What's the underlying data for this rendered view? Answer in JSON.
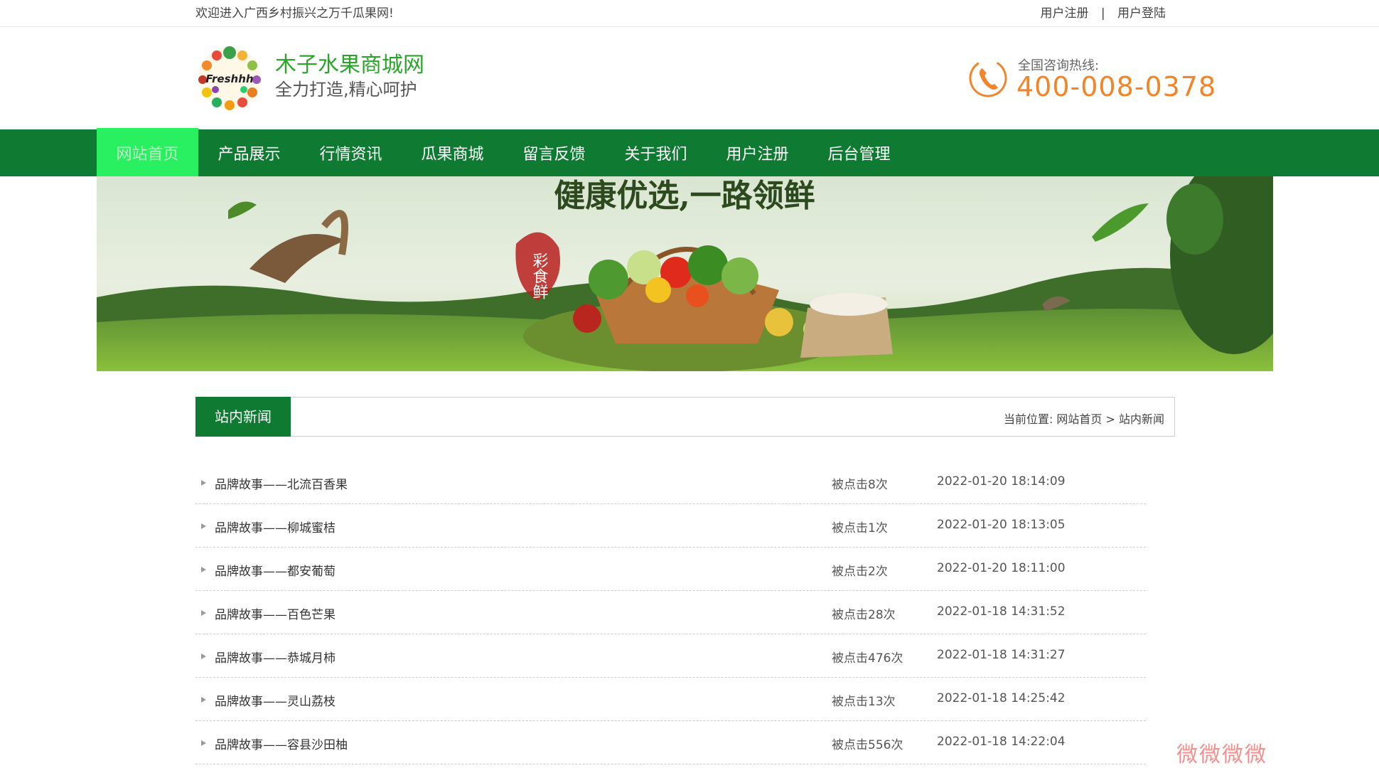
{
  "topbar": {
    "welcome": "欢迎进入广西乡村振兴之万千瓜果网!",
    "register": "用户注册",
    "separator": "|",
    "login": "用户登陆"
  },
  "header": {
    "logo_text": "Freshhh",
    "brand_name": "木子水果商城网",
    "slogan": "全力打造,精心呵护",
    "hotline_label": "全国咨询热线:",
    "hotline_number": "400-008-0378"
  },
  "nav": {
    "items": [
      {
        "label": "网站首页",
        "active": true
      },
      {
        "label": "产品展示",
        "active": false
      },
      {
        "label": "行情资讯",
        "active": false
      },
      {
        "label": "瓜果商城",
        "active": false
      },
      {
        "label": "留言反馈",
        "active": false
      },
      {
        "label": "关于我们",
        "active": false
      },
      {
        "label": "用户注册",
        "active": false
      },
      {
        "label": "后台管理",
        "active": false
      }
    ]
  },
  "banner": {
    "headline": "健康优选,一路领鲜",
    "seal_text": "彩食鲜"
  },
  "section": {
    "tab_label": "站内新闻",
    "breadcrumb": "当前位置: 网站首页 > 站内新闻"
  },
  "news": [
    {
      "title": "品牌故事——北流百香果",
      "clicks": "被点击8次",
      "date": "2022-01-20 18:14:09"
    },
    {
      "title": "品牌故事——柳城蜜桔",
      "clicks": "被点击1次",
      "date": "2022-01-20 18:13:05"
    },
    {
      "title": "品牌故事——都安葡萄",
      "clicks": "被点击2次",
      "date": "2022-01-20 18:11:00"
    },
    {
      "title": "品牌故事——百色芒果",
      "clicks": "被点击28次",
      "date": "2022-01-18 14:31:52"
    },
    {
      "title": "品牌故事——恭城月柿",
      "clicks": "被点击476次",
      "date": "2022-01-18 14:31:27"
    },
    {
      "title": "品牌故事——灵山荔枝",
      "clicks": "被点击13次",
      "date": "2022-01-18 14:25:42"
    },
    {
      "title": "品牌故事——容县沙田柚",
      "clicks": "被点击556次",
      "date": "2022-01-18 14:22:04"
    }
  ],
  "watermark": "微微微微",
  "colors": {
    "nav_bg": "#0e7a32",
    "nav_active": "#28f060",
    "brand_green": "#2aa52a",
    "hotline_orange": "#f0852a"
  }
}
